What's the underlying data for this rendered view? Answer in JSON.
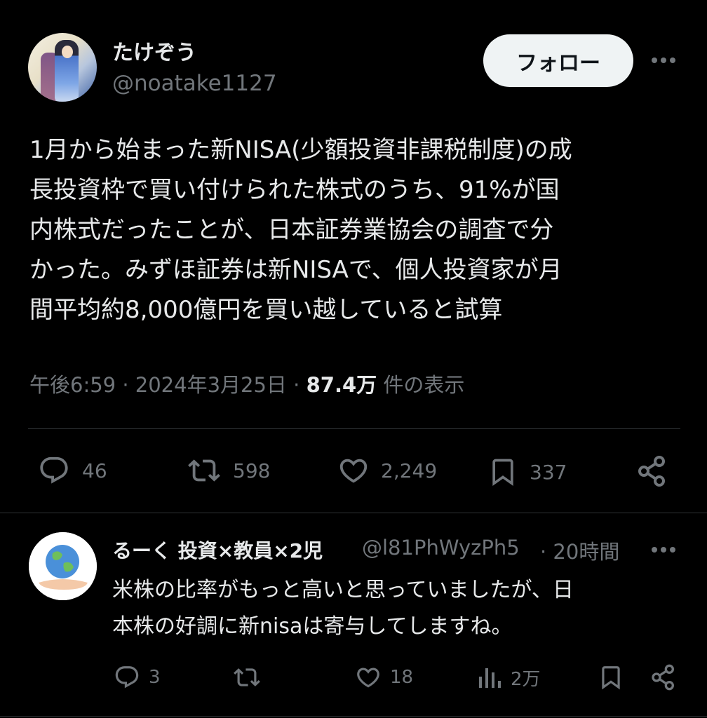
{
  "tweet": {
    "author_name": "たけぞう",
    "author_handle": "@noatake1127",
    "follow_label": "フォロー",
    "body_lines": [
      "1月から始まった新NISA(少額投資非課税制度)の成",
      "長投資枠で買い付けられた株式のうち、91%が国",
      "内株式だったことが、日本証券業協会の調査で分",
      "かった。みずほ証券は新NISAで、個人投資家が月",
      "間平均約8,000億円を買い越していると試算"
    ],
    "time": "午後6:59",
    "date": "2024年3月25日",
    "views_number": "87.4万",
    "views_label": "件の表示",
    "separator": "·",
    "stats": {
      "replies": "46",
      "retweets": "598",
      "likes": "2,249",
      "bookmarks": "337"
    }
  },
  "reply": {
    "author_name": "るーく 投資×教員×2児",
    "author_handle": "@l81PhWyzPh5",
    "time": "· 20時間",
    "body_lines": [
      "米株の比率がもっと高いと思っていましたが、日",
      "本株の好調に新nisaは寄与してしますね。"
    ],
    "stats": {
      "replies": "3",
      "likes": "18",
      "views": "2万"
    }
  },
  "icons": {
    "more": "more-horizontal-icon",
    "reply": "reply-icon",
    "retweet": "retweet-icon",
    "like": "heart-icon",
    "bookmark": "bookmark-icon",
    "share": "share-icon",
    "views": "analytics-icon"
  },
  "colors": {
    "background": "#000000",
    "text_primary": "#e7e9ea",
    "text_secondary": "#71767b",
    "divider": "#2f3336",
    "follow_bg": "#eff3f4"
  }
}
